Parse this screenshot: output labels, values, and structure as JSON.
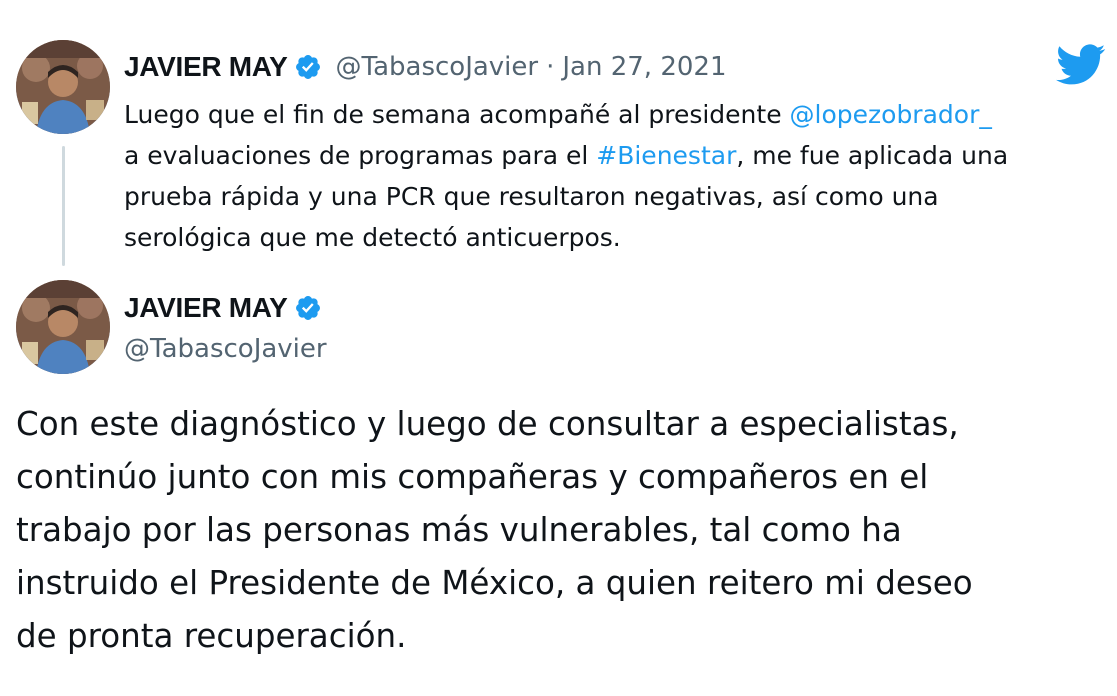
{
  "reply_tweet": {
    "author_name": "JAVIER MAY",
    "handle": "@TabascoJavier",
    "separator": "·",
    "date": "Jan 27, 2021",
    "lines": [
      {
        "before": "Luego que el fin de semana acompañé al presidente ",
        "link": "@lopezobrador_",
        "after": ""
      },
      {
        "before": "a evaluaciones de programas para el ",
        "link": "#Bienestar",
        "after": ", me fue aplicada una"
      },
      {
        "before": "prueba rápida y una PCR que resultaron negativas, así como una",
        "link": "",
        "after": ""
      },
      {
        "before": "serológica que me detectó anticuerpos.",
        "link": "",
        "after": ""
      }
    ]
  },
  "main_tweet": {
    "author_name": "JAVIER MAY",
    "handle": "@TabascoJavier",
    "lines": [
      "Con este diagnóstico y luego de consultar a especialistas,",
      "continúo junto con mis compañeras y compañeros en el",
      "trabajo por las personas más vulnerables, tal como ha",
      "instruido el Presidente de México, a quien reitero mi deseo",
      "de pronta recuperación."
    ]
  },
  "icons": {
    "brand": "twitter-bird-icon",
    "verified": "verified-badge-icon"
  },
  "colors": {
    "link": "#1d9bf0",
    "secondary_text": "#536471",
    "primary_text": "#0f1419",
    "thread_line": "#cfd9de",
    "brand": "#1d9bf0"
  }
}
